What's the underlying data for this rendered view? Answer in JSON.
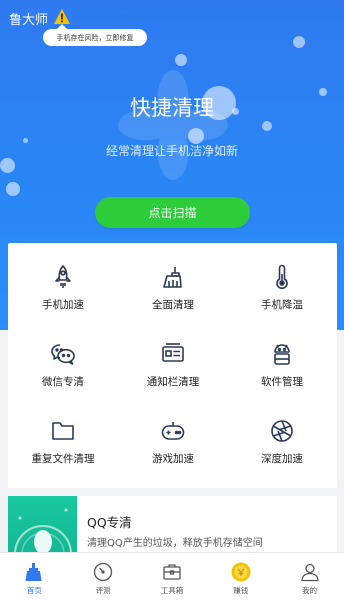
{
  "header": {
    "app_name": "鲁大师",
    "risk_notice": "手机存在风险，立即修复",
    "title": "快捷清理",
    "subtitle": "经常清理让手机洁净如新",
    "scan_button": "点击扫描"
  },
  "tools": [
    {
      "label": "手机加速",
      "icon": "rocket-icon"
    },
    {
      "label": "全面清理",
      "icon": "broom-icon"
    },
    {
      "label": "手机降温",
      "icon": "thermometer-icon"
    },
    {
      "label": "微信专清",
      "icon": "wechat-icon"
    },
    {
      "label": "通知栏清理",
      "icon": "notification-card-icon"
    },
    {
      "label": "软件管理",
      "icon": "android-icon"
    },
    {
      "label": "重复文件清理",
      "icon": "folder-icon"
    },
    {
      "label": "游戏加速",
      "icon": "gamepad-icon"
    },
    {
      "label": "深度加速",
      "icon": "aperture-icon"
    }
  ],
  "qq_card": {
    "title": "QQ专清",
    "description": "清理QQ产生的垃圾，释放手机存储空间"
  },
  "tabbar": [
    {
      "label": "首页",
      "icon": "home-broom-icon",
      "active": true
    },
    {
      "label": "评测",
      "icon": "gauge-icon",
      "active": false
    },
    {
      "label": "工具箱",
      "icon": "toolbox-icon",
      "active": false
    },
    {
      "label": "赚钱",
      "icon": "coin-icon",
      "active": false
    },
    {
      "label": "我的",
      "icon": "person-icon",
      "active": false
    }
  ],
  "colors": {
    "primary_blue": "#2f7af0",
    "scan_green": "#2dcc3a",
    "warning_yellow": "#f5c400",
    "icon_navy": "#2b3a55",
    "qq_teal": "#19c9a0"
  }
}
